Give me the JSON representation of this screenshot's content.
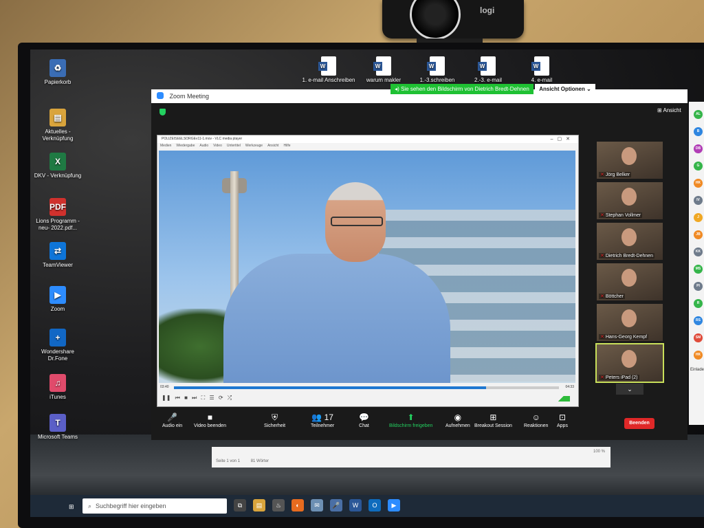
{
  "webcam": {
    "brand": "logi"
  },
  "desktop_left": [
    {
      "name": "recycle-bin",
      "label": "Papierkorb",
      "glyph": "♻",
      "color": "#3a6db5"
    },
    {
      "name": "folder-aktuelles",
      "label": "Aktuelles - Verknüpfung",
      "glyph": "▤",
      "color": "#d9a43c"
    },
    {
      "name": "excel-dkv",
      "label": "DKV - Verknüpfung",
      "glyph": "X",
      "color": "#1f7a43"
    },
    {
      "name": "pdf-lions",
      "label": "Lions Programm -neu- 2022.pdf...",
      "glyph": "PDF",
      "color": "#d0312d"
    },
    {
      "name": "teamviewer",
      "label": "TeamViewer",
      "glyph": "⇄",
      "color": "#0e75d9"
    },
    {
      "name": "zoom-app",
      "label": "Zoom",
      "glyph": "▶",
      "color": "#2d8cff"
    },
    {
      "name": "drfone",
      "label": "Wondershare Dr.Fone",
      "glyph": "+",
      "color": "#1167c5"
    },
    {
      "name": "itunes",
      "label": "iTunes",
      "glyph": "♫",
      "color": "#e04b6b"
    },
    {
      "name": "teams",
      "label": "Microsoft Teams",
      "glyph": "T",
      "color": "#5b5fc7"
    }
  ],
  "desktop_top": [
    {
      "label": "1. e-mail Anschreiben"
    },
    {
      "label": "warum makler"
    },
    {
      "label": "1.-3.schreiben"
    },
    {
      "label": "2.-3. e-mail"
    },
    {
      "label": "4. e-mail"
    }
  ],
  "zoom": {
    "title": "Zoom Meeting",
    "share_notice": "Sie sehen den Bildschirm von Dietrich Bredt-Dehnen",
    "view_options": "Ansicht Optionen ⌄",
    "view": "⊞ Ansicht",
    "end_button": "Beenden"
  },
  "vlc": {
    "title": "POLIZEISEELSORGEv11-1.mov - VLC media player",
    "menus": [
      "Medien",
      "Wiedergabe",
      "Audio",
      "Video",
      "Untertitel",
      "Werkzeuge",
      "Ansicht",
      "Hilfe"
    ],
    "time_elapsed": "03:40",
    "time_total": "04:33",
    "progress": 0.81
  },
  "participants": [
    {
      "name": "Jörg Belker"
    },
    {
      "name": "Stephan Vollmer"
    },
    {
      "name": "Dietrich Bredt-Dehnen"
    },
    {
      "name": "Böttcher"
    },
    {
      "name": "Hans-Georg Kempf"
    },
    {
      "name": "Peters iPad (2)"
    }
  ],
  "toolbar": [
    {
      "name": "audio-button",
      "icon": "🎤",
      "label": "Audio ein"
    },
    {
      "name": "video-button",
      "icon": "■",
      "label": "Video beenden"
    },
    {
      "name": "security-button",
      "icon": "⛨",
      "label": "Sicherheit"
    },
    {
      "name": "participants-button",
      "icon": "👥 17",
      "label": "Teilnehmer"
    },
    {
      "name": "chat-button",
      "icon": "💬",
      "label": "Chat"
    },
    {
      "name": "share-screen-button",
      "icon": "⬆",
      "label": "Bildschirm freigeben"
    },
    {
      "name": "record-button",
      "icon": "◉",
      "label": "Aufnehmen"
    },
    {
      "name": "breakout-button",
      "icon": "⊞",
      "label": "Breakout Session"
    },
    {
      "name": "reactions-button",
      "icon": "☺",
      "label": "Reaktionen"
    },
    {
      "name": "apps-button",
      "icon": "⊡",
      "label": "Apps"
    }
  ],
  "side_avatars": [
    {
      "initials": "AL",
      "color": "#35b54a"
    },
    {
      "initials": "B",
      "color": "#2f86e0"
    },
    {
      "initials": "DB",
      "color": "#b13db6"
    },
    {
      "initials": "G",
      "color": "#35b54a"
    },
    {
      "initials": "HK",
      "color": "#f08a24"
    },
    {
      "initials": "IV",
      "color": "#6e7b8b"
    },
    {
      "initials": "J",
      "color": "#f0a824"
    },
    {
      "initials": "JB",
      "color": "#f08a24"
    },
    {
      "initials": "KK",
      "color": "#6e7b8b"
    },
    {
      "initials": "MS",
      "color": "#35b54a"
    },
    {
      "initials": "PI",
      "color": "#6e7b8b"
    },
    {
      "initials": "R",
      "color": "#35b54a"
    },
    {
      "initials": "RS",
      "color": "#2f86e0"
    },
    {
      "initials": "SM",
      "color": "#e04b3a"
    },
    {
      "initials": "HK",
      "color": "#f08a24"
    }
  ],
  "side_panel": {
    "invite": "Einlade"
  },
  "word": {
    "page": "Seite 1 von 1",
    "words": "81 Wörter",
    "zoom": "100 %"
  },
  "taskbar": {
    "search_placeholder": "Suchbegriff hier eingeben"
  }
}
